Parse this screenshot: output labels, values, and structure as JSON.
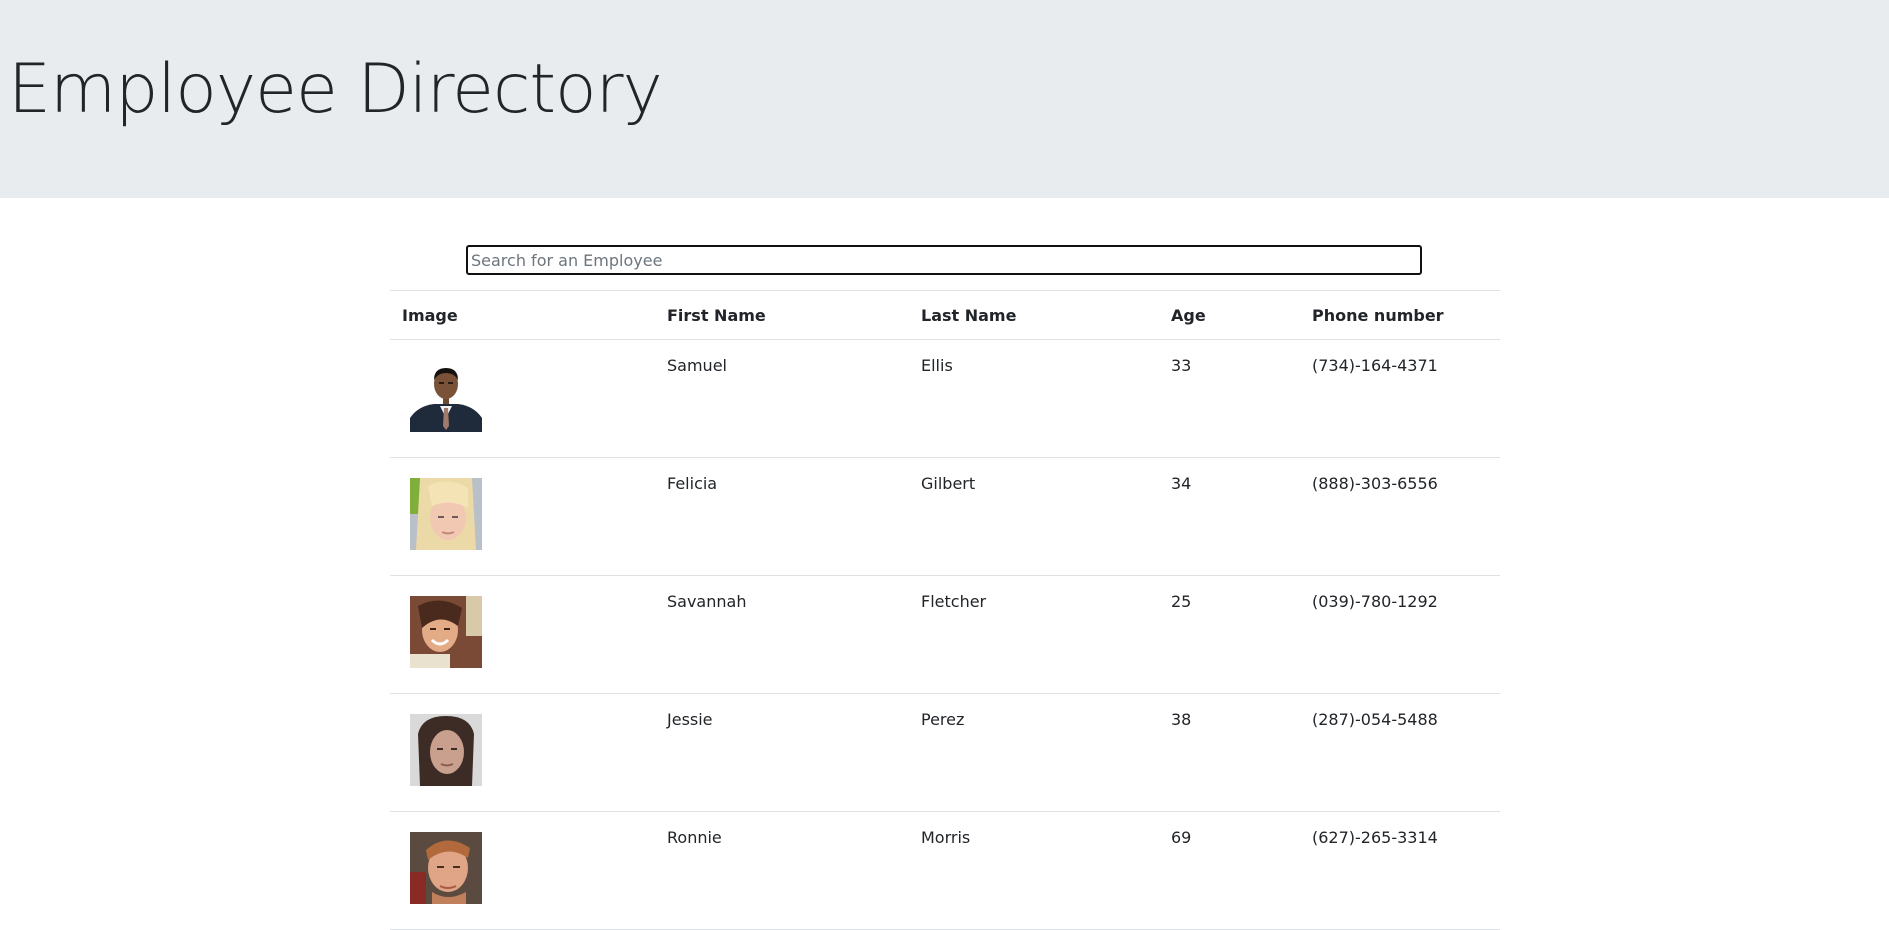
{
  "header": {
    "title": "Employee Directory"
  },
  "search": {
    "placeholder": "Search for an Employee",
    "value": ""
  },
  "table": {
    "columns": [
      "Image",
      "First Name",
      "Last Name",
      "Age",
      "Phone number"
    ],
    "rows": [
      {
        "first": "Samuel",
        "last": "Ellis",
        "age": "33",
        "phone": "(734)-164-4371",
        "avatar": "portrait-man-suit"
      },
      {
        "first": "Felicia",
        "last": "Gilbert",
        "age": "34",
        "phone": "(888)-303-6556",
        "avatar": "portrait-blonde-woman"
      },
      {
        "first": "Savannah",
        "last": "Fletcher",
        "age": "25",
        "phone": "(039)-780-1292",
        "avatar": "portrait-smiling-woman"
      },
      {
        "first": "Jessie",
        "last": "Perez",
        "age": "38",
        "phone": "(287)-054-5488",
        "avatar": "portrait-dark-hair-woman"
      },
      {
        "first": "Ronnie",
        "last": "Morris",
        "age": "69",
        "phone": "(627)-265-3314",
        "avatar": "portrait-man-ginger"
      }
    ]
  },
  "colors": {
    "header_bg": "#e9ecef",
    "text": "#212529",
    "border": "#dee2e6"
  }
}
